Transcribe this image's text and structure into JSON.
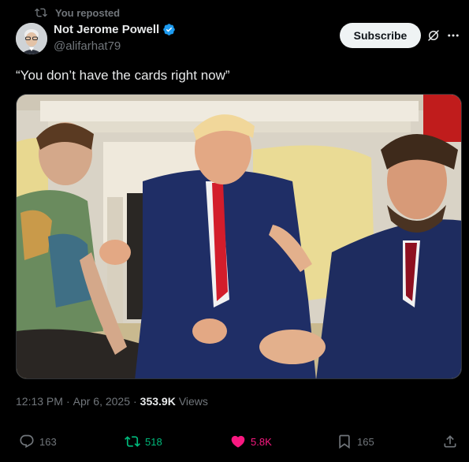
{
  "repost": {
    "label": "You reposted"
  },
  "author": {
    "name": "Not Jerome Powell",
    "handle": "@alifarhat79"
  },
  "subscribe_label": "Subscribe",
  "tweet": {
    "text": "“You don’t have the cards right now”"
  },
  "meta": {
    "time": "12:13 PM",
    "date": "Apr 6, 2025",
    "views": "353.9K",
    "views_label": "Views",
    "sep": "·"
  },
  "actions": {
    "replies": "163",
    "reposts": "518",
    "likes": "5.8K",
    "bookmarks": "165"
  },
  "colors": {
    "verified": "#1d9bf0",
    "repost": "#00ba7c",
    "like": "#f91880",
    "muted": "#71767b"
  },
  "icons": [
    "repost-icon",
    "verified-badge-icon",
    "grok-icon",
    "more-icon",
    "reply-icon",
    "retweet-icon",
    "heart-icon",
    "bookmark-icon",
    "share-icon"
  ]
}
